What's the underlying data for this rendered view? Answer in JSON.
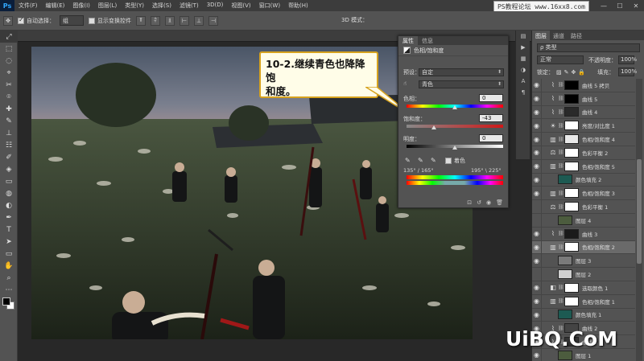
{
  "app": {
    "logo": "Ps"
  },
  "menubar": {
    "items": [
      "文件(F)",
      "编辑(E)",
      "图像(I)",
      "图层(L)",
      "类型(Y)",
      "选择(S)",
      "滤镜(T)",
      "3D(D)",
      "视图(V)",
      "窗口(W)",
      "帮助(H)"
    ],
    "watermark": "PS教程论坛 www.16xx8.com",
    "window_buttons": [
      "—",
      "☐",
      "✕"
    ]
  },
  "optionsbar": {
    "tool_glyph": "✥",
    "auto_select_label": "自动选择：",
    "auto_select_value": "组",
    "show_transform_label": "显示变换控件",
    "mode_3d_label": "3D 模式："
  },
  "toolbar": {
    "tools": [
      "⤢",
      "⬚",
      "◌",
      "⌖",
      "✂",
      "⌾",
      "✚",
      "✎",
      "⊥",
      "☷",
      "✐",
      "◈",
      "▭",
      "◍",
      "◐",
      "✒",
      "T",
      "➤",
      "▭",
      "✋",
      "⌕",
      "⋯"
    ]
  },
  "callout": {
    "text_line1": "10-2.继续青色也降降饱",
    "text_line2": "和度。"
  },
  "properties": {
    "tabs": [
      "属性",
      "信息"
    ],
    "title": "色相/饱和度",
    "preset_label": "预设：",
    "preset_value": "自定",
    "channel_value": "青色",
    "hue_label": "色相：",
    "hue_value": "0",
    "saturation_label": "饱和度：",
    "saturation_value": "-43",
    "lightness_label": "明度：",
    "lightness_value": "0",
    "colorize_label": "着色",
    "range_left": "135° / 165°",
    "range_right": "195° \\ 225°",
    "footer_icons": [
      "⊡",
      "↺",
      "◉",
      "🗑"
    ]
  },
  "layers": {
    "tabs": [
      "图层",
      "通道",
      "路径"
    ],
    "filter_label": "ρ 类型",
    "blend_mode": "正常",
    "opacity_label": "不透明度：",
    "opacity_value": "100%",
    "lock_label": "锁定：",
    "fill_label": "填充：",
    "fill_value": "100%",
    "items": [
      {
        "name": "曲线 5 拷贝",
        "kind": "adj",
        "adj_icon": "⌇",
        "thumb": "#000000",
        "visible": true,
        "selected": false
      },
      {
        "name": "曲线 5",
        "kind": "adj",
        "adj_icon": "⌇",
        "thumb": "#000000",
        "visible": true,
        "selected": false
      },
      {
        "name": "曲线 4",
        "kind": "adj",
        "adj_icon": "⌇",
        "thumb": "#2a2a2a",
        "visible": true,
        "selected": false
      },
      {
        "name": "亮度/对比度 1",
        "kind": "adj",
        "adj_icon": "☀",
        "thumb": "#ffffff",
        "visible": true,
        "selected": false
      },
      {
        "name": "色相/饱和度 4",
        "kind": "adj",
        "adj_icon": "▥",
        "thumb": "#e8e8e8",
        "visible": true,
        "selected": false
      },
      {
        "name": "色彩平衡 2",
        "kind": "adj",
        "adj_icon": "⚖",
        "thumb": "#ffffff",
        "visible": true,
        "selected": false
      },
      {
        "name": "色相/饱和度 5",
        "kind": "adj",
        "adj_icon": "▥",
        "thumb": "#ffffff",
        "visible": true,
        "selected": false
      },
      {
        "name": "颜色填充 2",
        "kind": "fill",
        "adj_icon": "",
        "thumb": "#1d5a52",
        "visible": true,
        "selected": false
      },
      {
        "name": "色相/饱和度 3",
        "kind": "adj",
        "adj_icon": "▥",
        "thumb": "#ffffff",
        "visible": true,
        "selected": false
      },
      {
        "name": "色彩平衡 1",
        "kind": "adj",
        "adj_icon": "⚖",
        "thumb": "#ffffff",
        "visible": false,
        "selected": false
      },
      {
        "name": "图层 4",
        "kind": "pixel",
        "adj_icon": "",
        "thumb": "#4c5c3e",
        "visible": false,
        "selected": false
      },
      {
        "name": "曲线 3",
        "kind": "adj",
        "adj_icon": "⌇",
        "thumb": "#1a1a1a",
        "visible": true,
        "selected": false
      },
      {
        "name": "色相/饱和度 2",
        "kind": "adj",
        "adj_icon": "▥",
        "thumb": "#ffffff",
        "visible": true,
        "selected": true
      },
      {
        "name": "图层 3",
        "kind": "pixel",
        "adj_icon": "",
        "thumb": "#7a7a7a",
        "visible": true,
        "selected": false
      },
      {
        "name": "图层 2",
        "kind": "pixel",
        "adj_icon": "",
        "thumb": "#cfcfcf",
        "visible": false,
        "selected": false
      },
      {
        "name": "选取颜色 1",
        "kind": "adj",
        "adj_icon": "◧",
        "thumb": "#ffffff",
        "visible": true,
        "selected": false
      },
      {
        "name": "色相/饱和度 1",
        "kind": "adj",
        "adj_icon": "▥",
        "thumb": "#ffffff",
        "visible": true,
        "selected": false
      },
      {
        "name": "颜色填充 1",
        "kind": "fill",
        "adj_icon": "",
        "thumb": "#1d5a52",
        "visible": true,
        "selected": false
      },
      {
        "name": "曲线 2",
        "kind": "adj",
        "adj_icon": "⌇",
        "thumb": "#444444",
        "visible": true,
        "selected": false
      },
      {
        "name": "曲线 1",
        "kind": "adj",
        "adj_icon": "⌇",
        "thumb": "#333333",
        "visible": true,
        "selected": false
      },
      {
        "name": "图层 1",
        "kind": "pixel",
        "adj_icon": "",
        "thumb": "#4c5c3e",
        "visible": true,
        "selected": false
      }
    ]
  },
  "watermark_bottom": "UiBQ.CoM"
}
